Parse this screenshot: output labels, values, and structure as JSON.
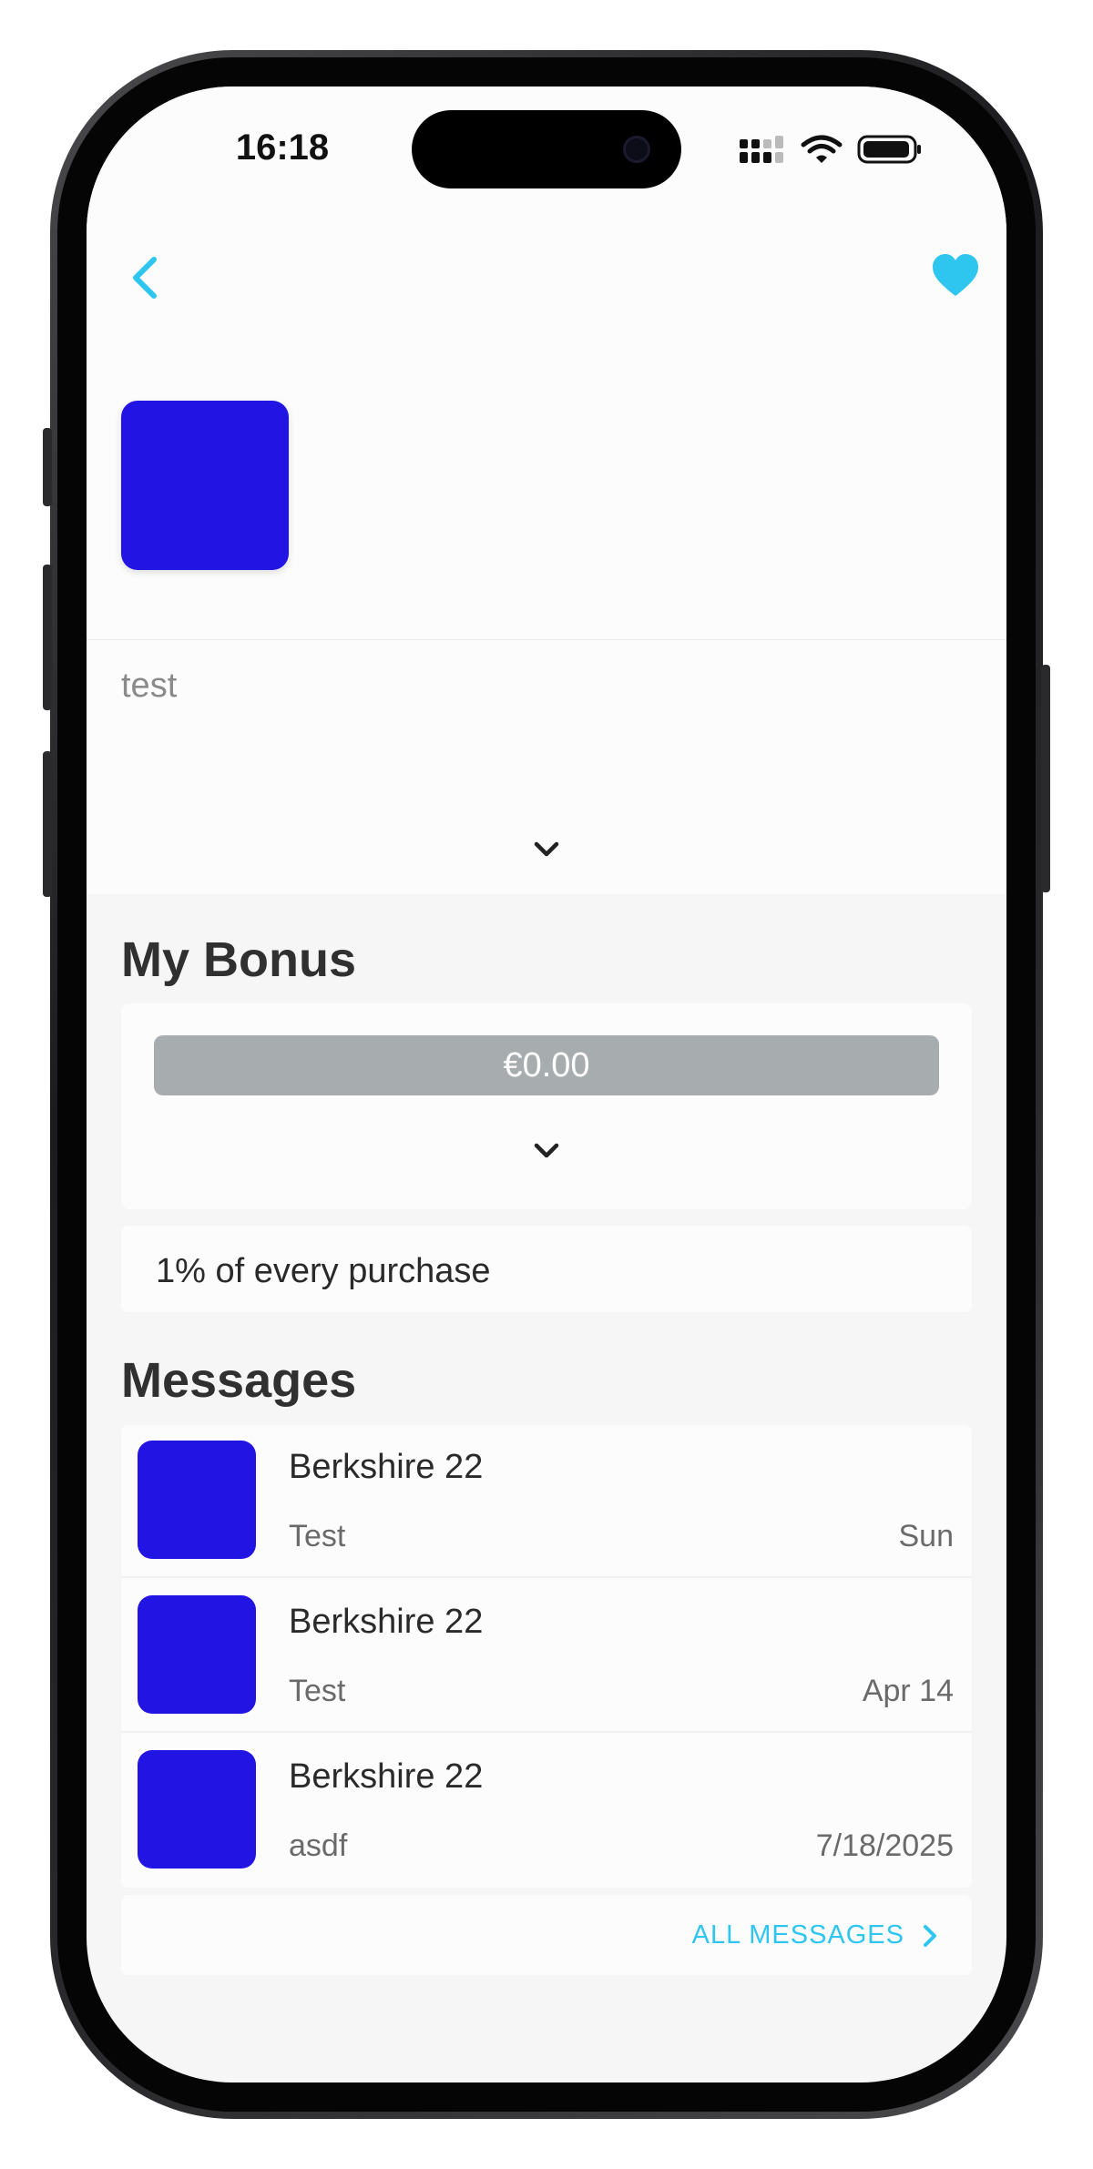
{
  "status_bar": {
    "time": "16:18",
    "signal_icon": "cellular-signal-icon",
    "wifi_icon": "wifi-icon",
    "battery_icon": "battery-icon"
  },
  "header": {
    "back_icon": "chevron-left-icon",
    "favorite_icon": "heart-icon",
    "accent_color": "#2ec6ef"
  },
  "store": {
    "logo_color": "#2214e3",
    "description": "test",
    "expand_icon": "chevron-down-icon"
  },
  "bonus": {
    "title": "My Bonus",
    "amount": "€0.00",
    "expand_icon": "chevron-down-icon",
    "rate_text": "1% of every purchase"
  },
  "messages": {
    "title": "Messages",
    "items": [
      {
        "sender": "Berkshire 22",
        "preview": "Test",
        "date": "Sun"
      },
      {
        "sender": "Berkshire 22",
        "preview": "Test",
        "date": "Apr 14"
      },
      {
        "sender": "Berkshire 22",
        "preview": "asdf",
        "date": "7/18/2025"
      }
    ],
    "all_label": "ALL MESSAGES",
    "all_icon": "chevron-right-icon"
  }
}
